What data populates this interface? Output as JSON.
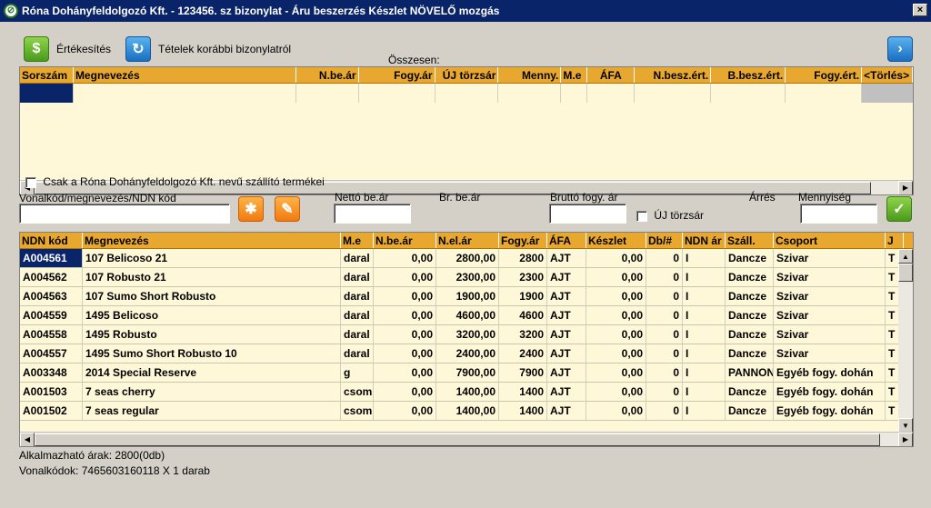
{
  "window": {
    "title": "Róna Dohányfeldolgozó Kft. - 123456. sz bizonylat - Áru beszerzés Készlet NÖVELŐ mozgás",
    "close": "×"
  },
  "toolbar": {
    "sales_label": "Értékesítés",
    "items_label": "Tételek korábbi bizonylatról",
    "sum_label": "Összesen:"
  },
  "top_grid": {
    "headers": [
      "Sorszám",
      "Megnevezés",
      "N.be.ár",
      "Fogy.ár",
      "ÚJ törzsár",
      "Menny.",
      "M.e",
      "ÁFA",
      "N.besz.ért.",
      "B.besz.ért.",
      "Fogy.ért.",
      "<Törlés>"
    ]
  },
  "filters": {
    "supplier_check_label": "Csak a Róna Dohányfeldolgozó Kft. nevű szállító termékei",
    "search_label": "Vonalkód/megnevezés/NDN kód",
    "net_price_label": "Nettó be.ár",
    "gross_price_label": "Br. be.ár",
    "gross_sale_label": "Bruttó fogy. ár",
    "new_price_label": "ÚJ törzsár",
    "margin_label": "Árrés",
    "qty_label": "Mennyiség"
  },
  "product_grid": {
    "headers": [
      "NDN kód",
      "Megnevezés",
      "M.e",
      "N.be.ár",
      "N.el.ár",
      "Fogy.ár",
      "ÁFA",
      "Készlet",
      "Db/#",
      "NDN ár",
      "Száll.",
      "Csoport",
      "J"
    ],
    "rows": [
      [
        "A004561",
        "107 Belicoso 21",
        "daral",
        "0,00",
        "2800,00",
        "2800",
        "AJT",
        "0,00",
        "0",
        "I",
        "Dancze",
        "Szivar",
        "T"
      ],
      [
        "A004562",
        "107 Robusto 21",
        "daral",
        "0,00",
        "2300,00",
        "2300",
        "AJT",
        "0,00",
        "0",
        "I",
        "Dancze",
        "Szivar",
        "T"
      ],
      [
        "A004563",
        "107 Sumo Short Robusto",
        "daral",
        "0,00",
        "1900,00",
        "1900",
        "AJT",
        "0,00",
        "0",
        "I",
        "Dancze",
        "Szivar",
        "T"
      ],
      [
        "A004559",
        "1495 Belicoso",
        "daral",
        "0,00",
        "4600,00",
        "4600",
        "AJT",
        "0,00",
        "0",
        "I",
        "Dancze",
        "Szivar",
        "T"
      ],
      [
        "A004558",
        "1495 Robusto",
        "daral",
        "0,00",
        "3200,00",
        "3200",
        "AJT",
        "0,00",
        "0",
        "I",
        "Dancze",
        "Szivar",
        "T"
      ],
      [
        "A004557",
        "1495 Sumo Short Robusto 10",
        "daral",
        "0,00",
        "2400,00",
        "2400",
        "AJT",
        "0,00",
        "0",
        "I",
        "Dancze",
        "Szivar",
        "T"
      ],
      [
        "A003348",
        "2014 Special Reserve",
        "g",
        "0,00",
        "7900,00",
        "7900",
        "AJT",
        "0,00",
        "0",
        "I",
        "PANNON",
        "Egyéb fogy. dohán",
        "T"
      ],
      [
        "A001503",
        "7 seas cherry",
        "csom",
        "0,00",
        "1400,00",
        "1400",
        "AJT",
        "0,00",
        "0",
        "I",
        "Dancze",
        "Egyéb fogy. dohán",
        "T"
      ],
      [
        "A001502",
        "7 seas regular",
        "csom",
        "0,00",
        "1400,00",
        "1400",
        "AJT",
        "0,00",
        "0",
        "I",
        "Dancze",
        "Egyéb fogy. dohán",
        "T"
      ]
    ]
  },
  "footer": {
    "prices": "Alkalmazható árak: 2800(0db)",
    "barcodes": "Vonalkódok: 7465603160118 X 1 darab"
  }
}
